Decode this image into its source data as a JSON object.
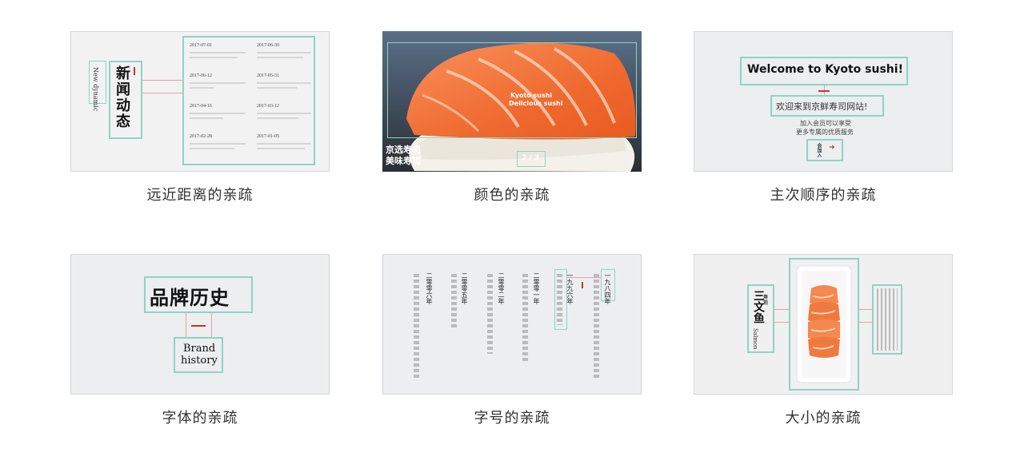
{
  "cards": [
    {
      "caption": "远近距离的亲疏",
      "title_cn": "新闻动态",
      "title_en": "New dynamic",
      "news": [
        {
          "date": "2017-07-01"
        },
        {
          "date": "2017-06-30"
        },
        {
          "date": "2017-06-12"
        },
        {
          "date": "2017-05-31"
        },
        {
          "date": "2017-04-16"
        },
        {
          "date": "2017-03-12"
        },
        {
          "date": "2017-02-28"
        },
        {
          "date": "2017-01-05"
        }
      ]
    },
    {
      "caption": "颜色的亲疏",
      "center_text_1": "Kyoto sushi",
      "center_text_2": "Delicious sushi",
      "corner_text_1": "京选寿司",
      "corner_text_2": "美味寿司",
      "pager": "2 / 3"
    },
    {
      "caption": "主次顺序的亲疏",
      "welcome": "Welcome to Kyoto sushi!",
      "welcome_cn": "欢迎来到京鲜寿司网站!",
      "sub_1": "加入会员可以享受",
      "sub_2": "更多专属的优质服务",
      "join": "会加入"
    },
    {
      "caption": "字体的亲疏",
      "title_cn": "品牌历史",
      "title_en_1": "Brand",
      "title_en_2": "history"
    },
    {
      "caption": "字号的亲疏",
      "years": [
        "二零零六年",
        "二零零五年",
        "二零零二年",
        "二零零一年",
        "一九九六年",
        "一九八四年"
      ]
    },
    {
      "caption": "大小的亲疏",
      "title_cn": "三文鱼",
      "title_small": "寿司",
      "title_en": "Salmon"
    }
  ],
  "colors": {
    "accent_teal": "#8fd3c4",
    "accent_red": "#c0392b",
    "salmon": "#f07a45"
  }
}
